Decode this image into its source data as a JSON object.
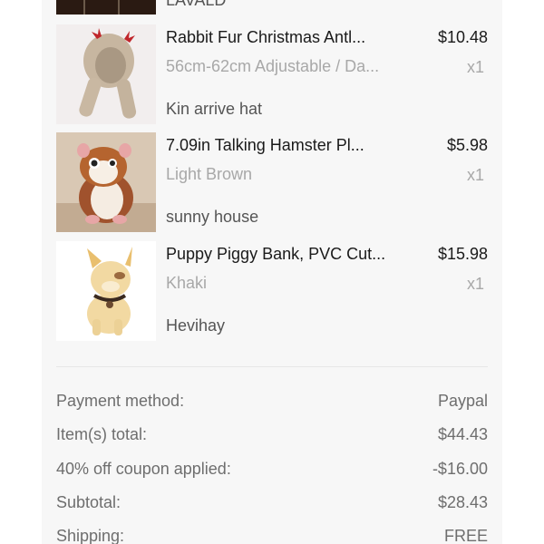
{
  "top_item": {
    "store": "LAVALD"
  },
  "items": [
    {
      "title": "Rabbit Fur Christmas Antl...",
      "price": "$10.48",
      "variant": "56cm-62cm Adjustable / Da...",
      "qty": "x1",
      "store": "Kin arrive hat",
      "image_icon": "rabbit-fur-hat-image"
    },
    {
      "title": "7.09in Talking Hamster Pl...",
      "price": "$5.98",
      "variant": "Light Brown",
      "qty": "x1",
      "store": "sunny house",
      "image_icon": "talking-hamster-image"
    },
    {
      "title": "Puppy Piggy Bank, PVC Cut...",
      "price": "$15.98",
      "variant": "Khaki",
      "qty": "x1",
      "store": "Hevihay",
      "image_icon": "puppy-piggy-bank-image"
    }
  ],
  "summary": [
    {
      "label": "Payment method:",
      "value": "Paypal"
    },
    {
      "label": "Item(s) total:",
      "value": "$44.43"
    },
    {
      "label": "40% off coupon applied:",
      "value": "-$16.00"
    },
    {
      "label": "Subtotal:",
      "value": "$28.43"
    },
    {
      "label": "Shipping:",
      "value": "FREE"
    }
  ],
  "colors": {
    "card_background": "#f7f7f7",
    "primary_text": "#1a1a1a",
    "secondary_text": "#a8a8a8",
    "store_text": "#555555",
    "summary_text": "#6e6e6e"
  }
}
